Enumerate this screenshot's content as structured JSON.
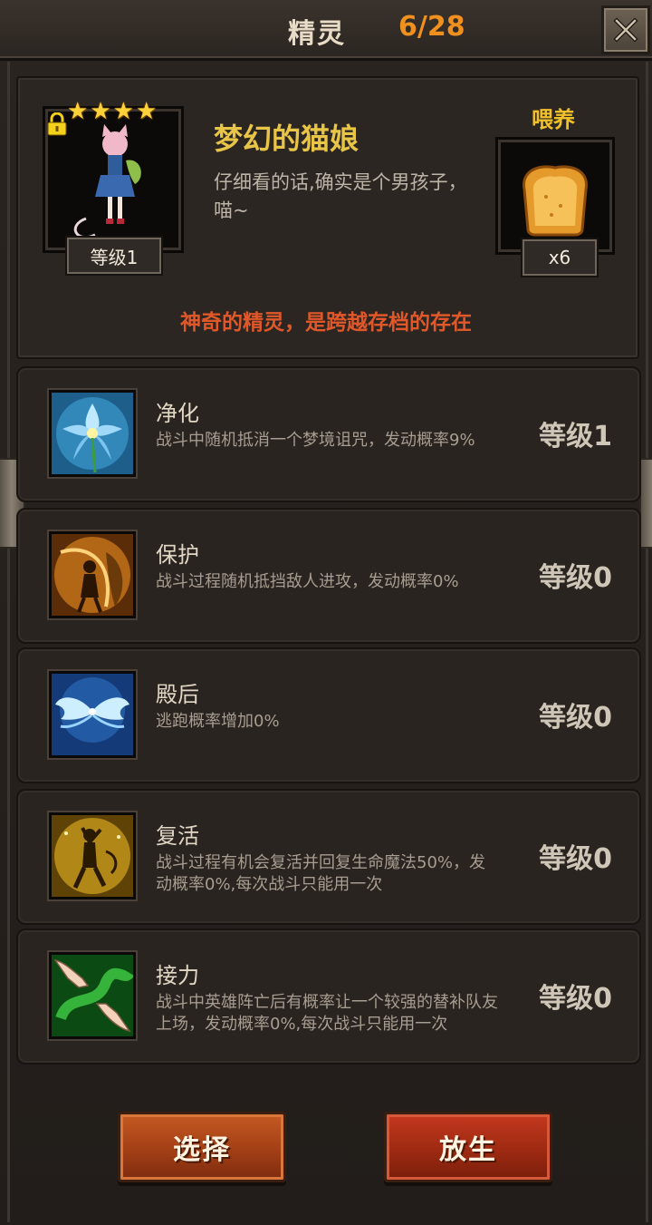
{
  "header": {
    "title": "精灵",
    "count": "6/28"
  },
  "pet": {
    "stars": [
      "★",
      "★",
      "★",
      "★"
    ],
    "level": "等级1",
    "name": "梦幻的猫娘",
    "description": "仔细看的话,确实是个男孩子，喵~",
    "feed_label": "喂养",
    "feed_count": "x6",
    "subtitle": "神奇的精灵，是跨越存档的存在"
  },
  "skills": [
    {
      "name": "净化",
      "desc": "战斗中随机抵消一个梦境诅咒，发动概率9%",
      "level": "等级1",
      "icon": "blue-flower-icon"
    },
    {
      "name": "保护",
      "desc": "战斗过程随机抵挡敌人进攻，发动概率0%",
      "level": "等级0",
      "icon": "fairy-shield-icon"
    },
    {
      "name": "殿后",
      "desc": "逃跑概率增加0%",
      "level": "等级0",
      "icon": "wings-icon"
    },
    {
      "name": "复活",
      "desc": "战斗过程有机会复活并回复生命魔法50%，发动概率0%,每次战斗只能用一次",
      "level": "等级0",
      "icon": "revive-figure-icon"
    },
    {
      "name": "接力",
      "desc": "战斗中英雄阵亡后有概率让一个较强的替补队友上场，发动概率0%,每次战斗只能用一次",
      "level": "等级0",
      "icon": "relay-hands-icon"
    }
  ],
  "buttons": {
    "select": "选择",
    "release": "放生"
  },
  "colors": {
    "accent_orange": "#f0901e",
    "name_gold": "#e9c547",
    "subtitle_red": "#e0582a"
  }
}
